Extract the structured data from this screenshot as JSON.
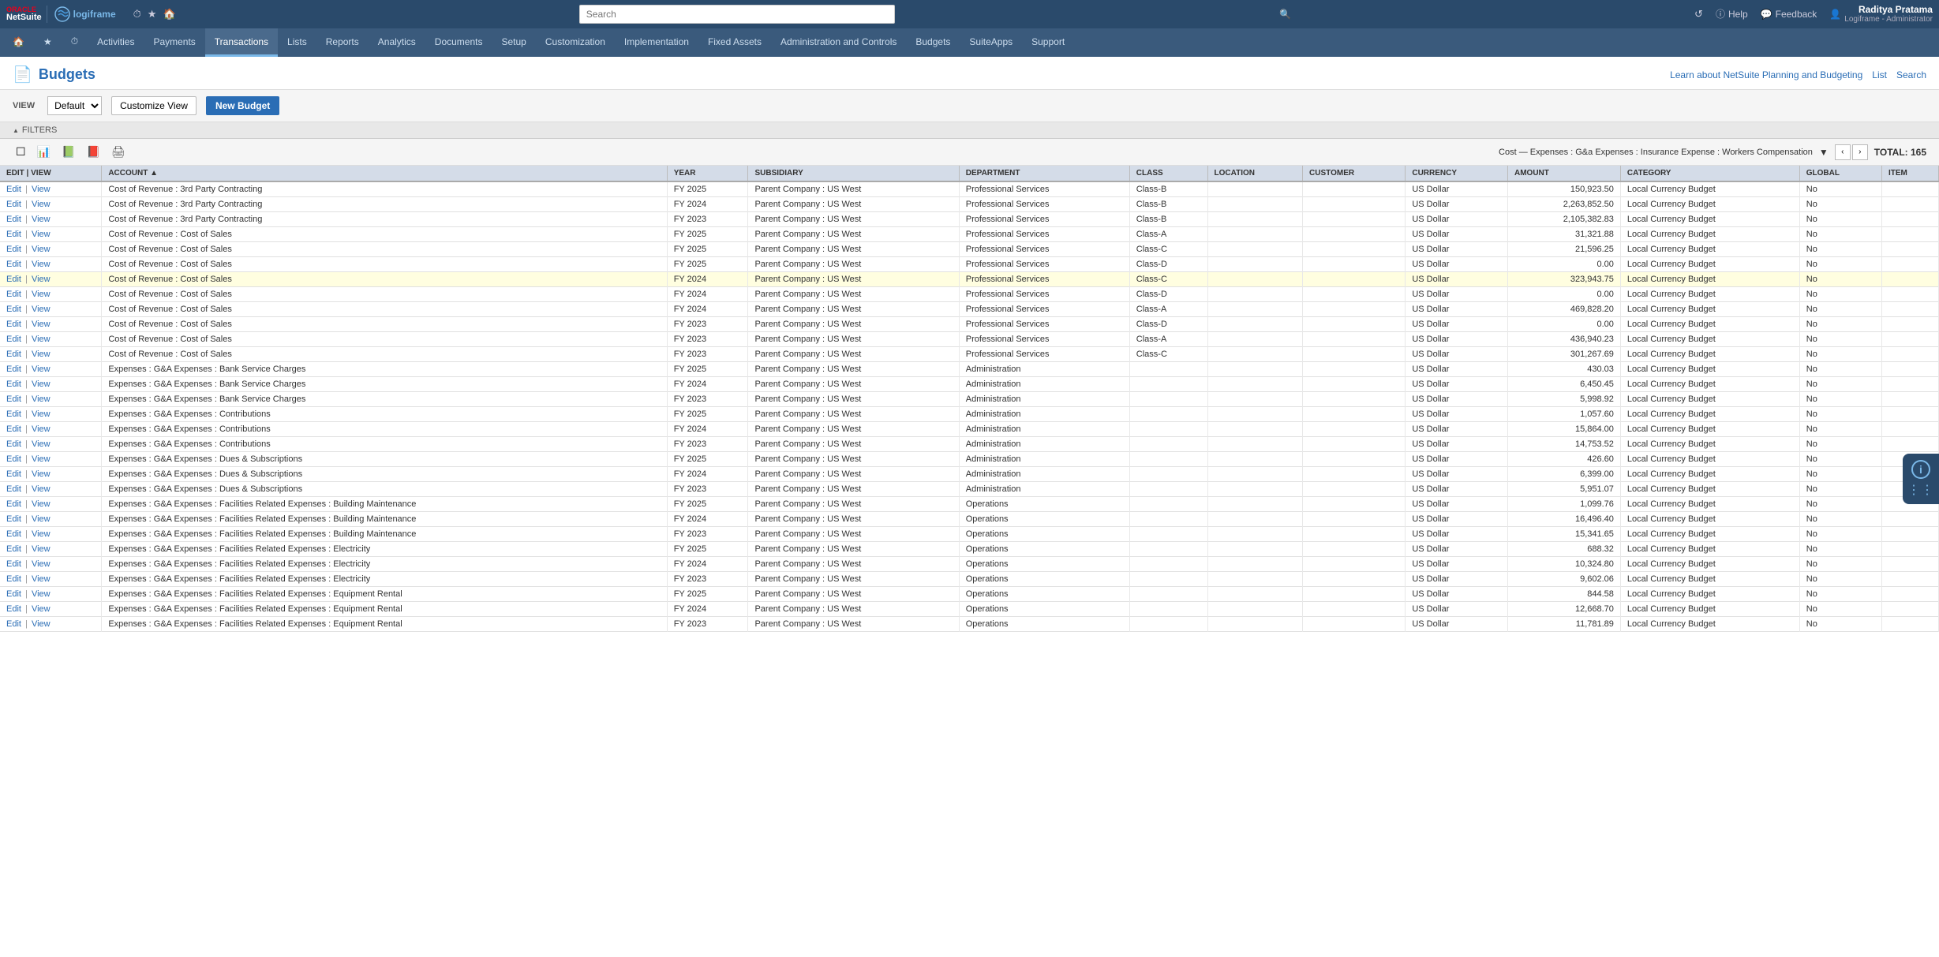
{
  "brand": {
    "oracle_text": "ORACLE",
    "netsuite_text": "NetSuite",
    "logiframe_text": "logiframe"
  },
  "topbar": {
    "search_placeholder": "Search",
    "help_label": "Help",
    "feedback_label": "Feedback",
    "user_name": "Raditya Pratama",
    "user_role": "Logiframe - Administrator",
    "history_icon": "↺",
    "question_icon": "?",
    "chat_icon": "💬",
    "user_icon": "👤"
  },
  "nav": {
    "items": [
      {
        "id": "home",
        "label": "🏠",
        "type": "icon"
      },
      {
        "id": "favorites",
        "label": "★",
        "type": "icon"
      },
      {
        "id": "recent",
        "label": "⏱",
        "type": "icon"
      },
      {
        "id": "activities",
        "label": "Activities"
      },
      {
        "id": "payments",
        "label": "Payments"
      },
      {
        "id": "transactions",
        "label": "Transactions",
        "active": true
      },
      {
        "id": "lists",
        "label": "Lists"
      },
      {
        "id": "reports",
        "label": "Reports"
      },
      {
        "id": "analytics",
        "label": "Analytics"
      },
      {
        "id": "documents",
        "label": "Documents"
      },
      {
        "id": "setup",
        "label": "Setup"
      },
      {
        "id": "customization",
        "label": "Customization"
      },
      {
        "id": "implementation",
        "label": "Implementation"
      },
      {
        "id": "fixed-assets",
        "label": "Fixed Assets"
      },
      {
        "id": "admin-controls",
        "label": "Administration and Controls"
      },
      {
        "id": "budgets",
        "label": "Budgets"
      },
      {
        "id": "suiteapps",
        "label": "SuiteApps"
      },
      {
        "id": "support",
        "label": "Support"
      }
    ]
  },
  "page": {
    "title": "Budgets",
    "icon": "📄",
    "header_links": [
      {
        "id": "learn",
        "label": "Learn about NetSuite Planning and Budgeting"
      },
      {
        "id": "list",
        "label": "List"
      },
      {
        "id": "search",
        "label": "Search"
      }
    ]
  },
  "toolbar": {
    "view_label": "VIEW",
    "view_default": "Default",
    "customize_view_label": "Customize View",
    "new_budget_label": "New Budget"
  },
  "filters": {
    "label": "FILTERS",
    "toggle_icon": "▲"
  },
  "table_toolbar": {
    "breadcrumb": "Cost — Expenses : G&a Expenses : Insurance Expense : Workers Compensation",
    "total_label": "TOTAL: 165",
    "prev_arrow": "‹",
    "next_arrow": "›"
  },
  "table": {
    "columns": [
      "EDIT | VIEW",
      "ACCOUNT ▲",
      "YEAR",
      "SUBSIDIARY",
      "DEPARTMENT",
      "CLASS",
      "LOCATION",
      "CUSTOMER",
      "CURRENCY",
      "AMOUNT",
      "CATEGORY",
      "GLOBAL",
      "ITEM"
    ],
    "rows": [
      {
        "account": "Cost of Revenue : 3rd Party Contracting",
        "year": "FY 2025",
        "subsidiary": "Parent Company : US West",
        "department": "Professional Services",
        "class": "Class-B",
        "location": "",
        "customer": "",
        "currency": "US Dollar",
        "amount": "150,923.50",
        "category": "Local Currency Budget",
        "global": "No",
        "item": "",
        "highlighted": false
      },
      {
        "account": "Cost of Revenue : 3rd Party Contracting",
        "year": "FY 2024",
        "subsidiary": "Parent Company : US West",
        "department": "Professional Services",
        "class": "Class-B",
        "location": "",
        "customer": "",
        "currency": "US Dollar",
        "amount": "2,263,852.50",
        "category": "Local Currency Budget",
        "global": "No",
        "item": "",
        "highlighted": false
      },
      {
        "account": "Cost of Revenue : 3rd Party Contracting",
        "year": "FY 2023",
        "subsidiary": "Parent Company : US West",
        "department": "Professional Services",
        "class": "Class-B",
        "location": "",
        "customer": "",
        "currency": "US Dollar",
        "amount": "2,105,382.83",
        "category": "Local Currency Budget",
        "global": "No",
        "item": "",
        "highlighted": false
      },
      {
        "account": "Cost of Revenue : Cost of Sales",
        "year": "FY 2025",
        "subsidiary": "Parent Company : US West",
        "department": "Professional Services",
        "class": "Class-A",
        "location": "",
        "customer": "",
        "currency": "US Dollar",
        "amount": "31,321.88",
        "category": "Local Currency Budget",
        "global": "No",
        "item": "",
        "highlighted": false
      },
      {
        "account": "Cost of Revenue : Cost of Sales",
        "year": "FY 2025",
        "subsidiary": "Parent Company : US West",
        "department": "Professional Services",
        "class": "Class-C",
        "location": "",
        "customer": "",
        "currency": "US Dollar",
        "amount": "21,596.25",
        "category": "Local Currency Budget",
        "global": "No",
        "item": "",
        "highlighted": false
      },
      {
        "account": "Cost of Revenue : Cost of Sales",
        "year": "FY 2025",
        "subsidiary": "Parent Company : US West",
        "department": "Professional Services",
        "class": "Class-D",
        "location": "",
        "customer": "",
        "currency": "US Dollar",
        "amount": "0.00",
        "category": "Local Currency Budget",
        "global": "No",
        "item": "",
        "highlighted": false
      },
      {
        "account": "Cost of Revenue : Cost of Sales",
        "year": "FY 2024",
        "subsidiary": "Parent Company : US West",
        "department": "Professional Services",
        "class": "Class-C",
        "location": "",
        "customer": "",
        "currency": "US Dollar",
        "amount": "323,943.75",
        "category": "Local Currency Budget",
        "global": "No",
        "item": "",
        "highlighted": true
      },
      {
        "account": "Cost of Revenue : Cost of Sales",
        "year": "FY 2024",
        "subsidiary": "Parent Company : US West",
        "department": "Professional Services",
        "class": "Class-D",
        "location": "",
        "customer": "",
        "currency": "US Dollar",
        "amount": "0.00",
        "category": "Local Currency Budget",
        "global": "No",
        "item": "",
        "highlighted": false
      },
      {
        "account": "Cost of Revenue : Cost of Sales",
        "year": "FY 2024",
        "subsidiary": "Parent Company : US West",
        "department": "Professional Services",
        "class": "Class-A",
        "location": "",
        "customer": "",
        "currency": "US Dollar",
        "amount": "469,828.20",
        "category": "Local Currency Budget",
        "global": "No",
        "item": "",
        "highlighted": false
      },
      {
        "account": "Cost of Revenue : Cost of Sales",
        "year": "FY 2023",
        "subsidiary": "Parent Company : US West",
        "department": "Professional Services",
        "class": "Class-D",
        "location": "",
        "customer": "",
        "currency": "US Dollar",
        "amount": "0.00",
        "category": "Local Currency Budget",
        "global": "No",
        "item": "",
        "highlighted": false
      },
      {
        "account": "Cost of Revenue : Cost of Sales",
        "year": "FY 2023",
        "subsidiary": "Parent Company : US West",
        "department": "Professional Services",
        "class": "Class-A",
        "location": "",
        "customer": "",
        "currency": "US Dollar",
        "amount": "436,940.23",
        "category": "Local Currency Budget",
        "global": "No",
        "item": "",
        "highlighted": false
      },
      {
        "account": "Cost of Revenue : Cost of Sales",
        "year": "FY 2023",
        "subsidiary": "Parent Company : US West",
        "department": "Professional Services",
        "class": "Class-C",
        "location": "",
        "customer": "",
        "currency": "US Dollar",
        "amount": "301,267.69",
        "category": "Local Currency Budget",
        "global": "No",
        "item": "",
        "highlighted": false
      },
      {
        "account": "Expenses : G&A Expenses : Bank Service Charges",
        "year": "FY 2025",
        "subsidiary": "Parent Company : US West",
        "department": "Administration",
        "class": "",
        "location": "",
        "customer": "",
        "currency": "US Dollar",
        "amount": "430.03",
        "category": "Local Currency Budget",
        "global": "No",
        "item": "",
        "highlighted": false
      },
      {
        "account": "Expenses : G&A Expenses : Bank Service Charges",
        "year": "FY 2024",
        "subsidiary": "Parent Company : US West",
        "department": "Administration",
        "class": "",
        "location": "",
        "customer": "",
        "currency": "US Dollar",
        "amount": "6,450.45",
        "category": "Local Currency Budget",
        "global": "No",
        "item": "",
        "highlighted": false
      },
      {
        "account": "Expenses : G&A Expenses : Bank Service Charges",
        "year": "FY 2023",
        "subsidiary": "Parent Company : US West",
        "department": "Administration",
        "class": "",
        "location": "",
        "customer": "",
        "currency": "US Dollar",
        "amount": "5,998.92",
        "category": "Local Currency Budget",
        "global": "No",
        "item": "",
        "highlighted": false
      },
      {
        "account": "Expenses : G&A Expenses : Contributions",
        "year": "FY 2025",
        "subsidiary": "Parent Company : US West",
        "department": "Administration",
        "class": "",
        "location": "",
        "customer": "",
        "currency": "US Dollar",
        "amount": "1,057.60",
        "category": "Local Currency Budget",
        "global": "No",
        "item": "",
        "highlighted": false
      },
      {
        "account": "Expenses : G&A Expenses : Contributions",
        "year": "FY 2024",
        "subsidiary": "Parent Company : US West",
        "department": "Administration",
        "class": "",
        "location": "",
        "customer": "",
        "currency": "US Dollar",
        "amount": "15,864.00",
        "category": "Local Currency Budget",
        "global": "No",
        "item": "",
        "highlighted": false
      },
      {
        "account": "Expenses : G&A Expenses : Contributions",
        "year": "FY 2023",
        "subsidiary": "Parent Company : US West",
        "department": "Administration",
        "class": "",
        "location": "",
        "customer": "",
        "currency": "US Dollar",
        "amount": "14,753.52",
        "category": "Local Currency Budget",
        "global": "No",
        "item": "",
        "highlighted": false
      },
      {
        "account": "Expenses : G&A Expenses : Dues & Subscriptions",
        "year": "FY 2025",
        "subsidiary": "Parent Company : US West",
        "department": "Administration",
        "class": "",
        "location": "",
        "customer": "",
        "currency": "US Dollar",
        "amount": "426.60",
        "category": "Local Currency Budget",
        "global": "No",
        "item": "",
        "highlighted": false
      },
      {
        "account": "Expenses : G&A Expenses : Dues & Subscriptions",
        "year": "FY 2024",
        "subsidiary": "Parent Company : US West",
        "department": "Administration",
        "class": "",
        "location": "",
        "customer": "",
        "currency": "US Dollar",
        "amount": "6,399.00",
        "category": "Local Currency Budget",
        "global": "No",
        "item": "",
        "highlighted": false
      },
      {
        "account": "Expenses : G&A Expenses : Dues & Subscriptions",
        "year": "FY 2023",
        "subsidiary": "Parent Company : US West",
        "department": "Administration",
        "class": "",
        "location": "",
        "customer": "",
        "currency": "US Dollar",
        "amount": "5,951.07",
        "category": "Local Currency Budget",
        "global": "No",
        "item": "",
        "highlighted": false
      },
      {
        "account": "Expenses : G&A Expenses : Facilities Related Expenses : Building Maintenance",
        "year": "FY 2025",
        "subsidiary": "Parent Company : US West",
        "department": "Operations",
        "class": "",
        "location": "",
        "customer": "",
        "currency": "US Dollar",
        "amount": "1,099.76",
        "category": "Local Currency Budget",
        "global": "No",
        "item": "",
        "highlighted": false
      },
      {
        "account": "Expenses : G&A Expenses : Facilities Related Expenses : Building Maintenance",
        "year": "FY 2024",
        "subsidiary": "Parent Company : US West",
        "department": "Operations",
        "class": "",
        "location": "",
        "customer": "",
        "currency": "US Dollar",
        "amount": "16,496.40",
        "category": "Local Currency Budget",
        "global": "No",
        "item": "",
        "highlighted": false
      },
      {
        "account": "Expenses : G&A Expenses : Facilities Related Expenses : Building Maintenance",
        "year": "FY 2023",
        "subsidiary": "Parent Company : US West",
        "department": "Operations",
        "class": "",
        "location": "",
        "customer": "",
        "currency": "US Dollar",
        "amount": "15,341.65",
        "category": "Local Currency Budget",
        "global": "No",
        "item": "",
        "highlighted": false
      },
      {
        "account": "Expenses : G&A Expenses : Facilities Related Expenses : Electricity",
        "year": "FY 2025",
        "subsidiary": "Parent Company : US West",
        "department": "Operations",
        "class": "",
        "location": "",
        "customer": "",
        "currency": "US Dollar",
        "amount": "688.32",
        "category": "Local Currency Budget",
        "global": "No",
        "item": "",
        "highlighted": false
      },
      {
        "account": "Expenses : G&A Expenses : Facilities Related Expenses : Electricity",
        "year": "FY 2024",
        "subsidiary": "Parent Company : US West",
        "department": "Operations",
        "class": "",
        "location": "",
        "customer": "",
        "currency": "US Dollar",
        "amount": "10,324.80",
        "category": "Local Currency Budget",
        "global": "No",
        "item": "",
        "highlighted": false
      },
      {
        "account": "Expenses : G&A Expenses : Facilities Related Expenses : Electricity",
        "year": "FY 2023",
        "subsidiary": "Parent Company : US West",
        "department": "Operations",
        "class": "",
        "location": "",
        "customer": "",
        "currency": "US Dollar",
        "amount": "9,602.06",
        "category": "Local Currency Budget",
        "global": "No",
        "item": "",
        "highlighted": false
      },
      {
        "account": "Expenses : G&A Expenses : Facilities Related Expenses : Equipment Rental",
        "year": "FY 2025",
        "subsidiary": "Parent Company : US West",
        "department": "Operations",
        "class": "",
        "location": "",
        "customer": "",
        "currency": "US Dollar",
        "amount": "844.58",
        "category": "Local Currency Budget",
        "global": "No",
        "item": "",
        "highlighted": false
      },
      {
        "account": "Expenses : G&A Expenses : Facilities Related Expenses : Equipment Rental",
        "year": "FY 2024",
        "subsidiary": "Parent Company : US West",
        "department": "Operations",
        "class": "",
        "location": "",
        "customer": "",
        "currency": "US Dollar",
        "amount": "12,668.70",
        "category": "Local Currency Budget",
        "global": "No",
        "item": "",
        "highlighted": false
      },
      {
        "account": "Expenses : G&A Expenses : Facilities Related Expenses : Equipment Rental",
        "year": "FY 2023",
        "subsidiary": "Parent Company : US West",
        "department": "Operations",
        "class": "",
        "location": "",
        "customer": "",
        "currency": "US Dollar",
        "amount": "11,781.89",
        "category": "Local Currency Budget",
        "global": "No",
        "item": "",
        "highlighted": false
      }
    ]
  }
}
